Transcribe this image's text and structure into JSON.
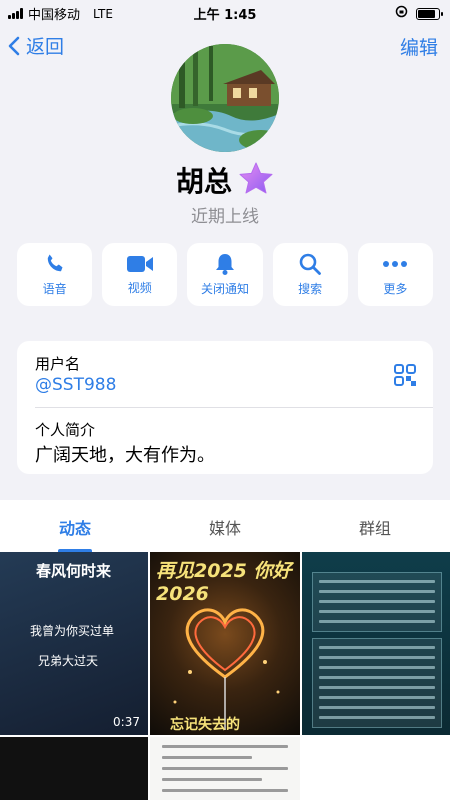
{
  "status_bar": {
    "carrier": "中国移动",
    "network": "LTE",
    "time": "上午 1:45"
  },
  "nav": {
    "back_label": "返回",
    "edit_label": "编辑"
  },
  "profile": {
    "name": "胡总",
    "presence": "近期上线"
  },
  "actions": [
    {
      "label": "语音",
      "icon": "phone-icon"
    },
    {
      "label": "视频",
      "icon": "video-icon"
    },
    {
      "label": "关闭通知",
      "icon": "bell-icon"
    },
    {
      "label": "搜索",
      "icon": "search-icon"
    },
    {
      "label": "更多",
      "icon": "more-icon"
    }
  ],
  "info": {
    "username_label": "用户名",
    "username": "@SST988",
    "bio_label": "个人简介",
    "bio": "广阔天地，大有作为。"
  },
  "tabs": [
    {
      "label": "动态",
      "active": true
    },
    {
      "label": "媒体",
      "active": false
    },
    {
      "label": "群组",
      "active": false
    }
  ],
  "media": {
    "item1": {
      "title": "春风何时来",
      "line1": "我曾为你买过单",
      "line2": "兄弟大过天",
      "duration": "0:37"
    },
    "item2": {
      "title": "再见2025 你好2026",
      "caption": "忘记失去的"
    }
  },
  "colors": {
    "accent": "#2f7ee6",
    "background": "#f2f2f7"
  }
}
